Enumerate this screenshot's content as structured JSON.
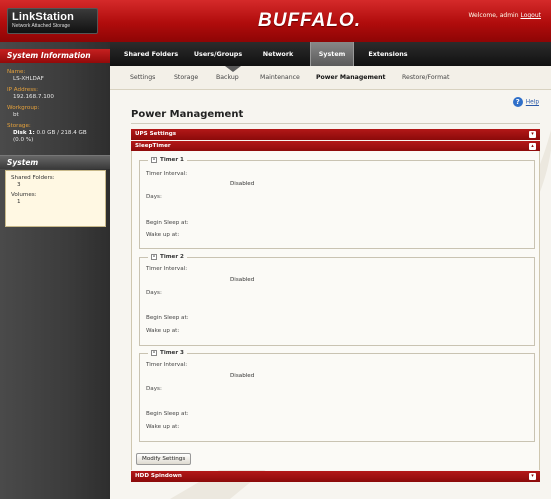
{
  "header": {
    "logo_title": "LinkStation",
    "logo_subtitle": "Network Attached Storage",
    "brand": "BUFFALO.",
    "welcome": "Welcome, admin",
    "logout": "Logout"
  },
  "sidebar": {
    "system_information": "System Information",
    "name_label": "Name:",
    "name_value": "LS-XHLDAF",
    "ip_label": "IP Address:",
    "ip_value": "192.168.7.100",
    "workgroup_label": "Workgroup:",
    "workgroup_value": "bt",
    "storage_label": "Storage:",
    "storage_disk": "Disk 1:",
    "storage_value": "0.0 GB / 218.4 GB",
    "storage_percent": "(0.0 %)",
    "system_title": "System",
    "shared_folders_label": "Shared Folders:",
    "shared_folders_value": "3",
    "volumes_label": "Volumes:",
    "volumes_value": "1"
  },
  "nav": {
    "tabs": [
      "Shared Folders",
      "Users/Groups",
      "Network",
      "System",
      "Extensions"
    ],
    "active": "System"
  },
  "subnav": {
    "tabs": [
      "Settings",
      "Storage",
      "Backup",
      "Maintenance",
      "Power Management",
      "Restore/Format"
    ],
    "active": "Power Management"
  },
  "main": {
    "help": "Help",
    "page_title": "Power Management",
    "ups_settings": "UPS Settings",
    "sleep_timer": "SleepTimer",
    "hdd_spindown": "HDD Spindown",
    "modify_settings": "Modify Settings",
    "timers": [
      {
        "title": "Timer 1",
        "interval_label": "Timer Interval:",
        "interval_value": "Disabled",
        "days_label": "Days:",
        "begin_label": "Begin Sleep at:",
        "wake_label": "Wake up at:"
      },
      {
        "title": "Timer 2",
        "interval_label": "Timer Interval:",
        "interval_value": "Disabled",
        "days_label": "Days:",
        "begin_label": "Begin Sleep at:",
        "wake_label": "Wake up at:"
      },
      {
        "title": "Timer 3",
        "interval_label": "Timer Interval:",
        "interval_value": "Disabled",
        "days_label": "Days:",
        "begin_label": "Begin Sleep at:",
        "wake_label": "Wake up at:"
      }
    ]
  },
  "colors": {
    "header_red": "#b00c0c",
    "panel_red": "#8b0a0a",
    "sidebar_dark": "#3c3c3c",
    "accent_orange": "#e6a23c",
    "help_blue": "#2f6fc9"
  },
  "icons": {
    "help": "help-icon",
    "collapse": "collapse-icon",
    "expand": "expand-icon"
  }
}
